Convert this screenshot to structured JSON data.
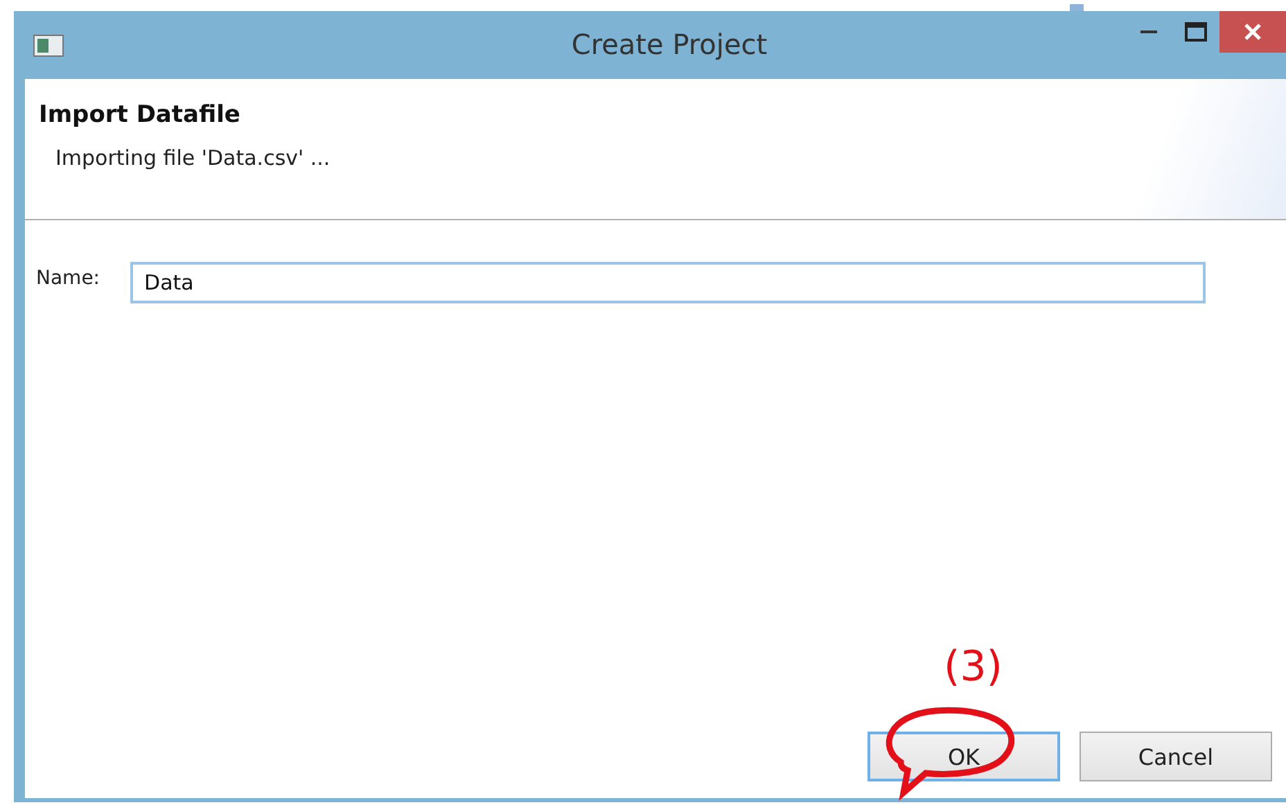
{
  "window": {
    "title": "Create Project"
  },
  "header": {
    "title": "Import Datafile",
    "message": "Importing file 'Data.csv' ..."
  },
  "form": {
    "fields": [
      {
        "label": "Name:",
        "value": "Data"
      }
    ]
  },
  "buttons": [
    {
      "label": "OK",
      "focused": true
    },
    {
      "label": "Cancel",
      "focused": false
    }
  ],
  "annotation": {
    "label": "(3)"
  }
}
